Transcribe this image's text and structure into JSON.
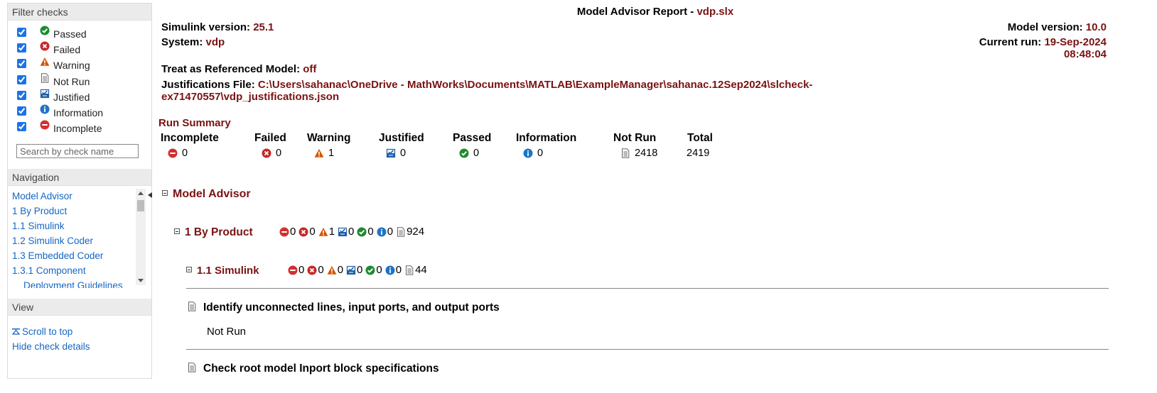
{
  "sidebar": {
    "filter": {
      "header": "Filter checks",
      "items": [
        {
          "label": "Passed",
          "icon": "passed-icon",
          "checked": true
        },
        {
          "label": "Failed",
          "icon": "failed-icon",
          "checked": true
        },
        {
          "label": "Warning",
          "icon": "warning-icon",
          "checked": true
        },
        {
          "label": "Not Run",
          "icon": "not-run-icon",
          "checked": true
        },
        {
          "label": "Justified",
          "icon": "justified-icon",
          "checked": true
        },
        {
          "label": "Information",
          "icon": "information-icon",
          "checked": true
        },
        {
          "label": "Incomplete",
          "icon": "incomplete-icon",
          "checked": true
        }
      ],
      "search_placeholder": "Search by check name"
    },
    "navigation": {
      "header": "Navigation",
      "items": [
        {
          "label": "Model Advisor"
        },
        {
          "label": "1 By Product"
        },
        {
          "label": "1.1 Simulink"
        },
        {
          "label": "1.2 Simulink Coder"
        },
        {
          "label": "1.3 Embedded Coder"
        },
        {
          "label": "1.3.1 Component"
        },
        {
          "label": "Deployment Guidelines"
        }
      ]
    },
    "view": {
      "header": "View",
      "scroll_to_top": "Scroll to top",
      "hide_details": "Hide check details"
    }
  },
  "report": {
    "title_prefix": "Model Advisor Report - ",
    "title_file": "vdp.slx",
    "simulink_version_label": "Simulink version: ",
    "simulink_version": "25.1",
    "system_label": "System: ",
    "system": "vdp",
    "model_version_label": "Model version: ",
    "model_version": "10.0",
    "current_run_label": "Current run: ",
    "current_run_date": "19-Sep-2024",
    "current_run_time": "08:48:04",
    "treat_label": "Treat as Referenced Model: ",
    "treat_value": "off",
    "justifications_label": "Justifications File: ",
    "justifications_line1": "C:\\Users\\sahanac\\OneDrive - MathWorks\\Documents\\MATLAB\\ExampleManager\\sahanac.12Sep2024\\slcheck-",
    "justifications_line2": "ex71470557\\vdp_justifications.json"
  },
  "run_summary": {
    "title": "Run Summary",
    "columns": [
      {
        "label": "Incomplete",
        "value": "0",
        "icon": "incomplete-icon"
      },
      {
        "label": "Failed",
        "value": "0",
        "icon": "failed-icon"
      },
      {
        "label": "Warning",
        "value": "1",
        "icon": "warning-icon"
      },
      {
        "label": "Justified",
        "value": "0",
        "icon": "justified-icon"
      },
      {
        "label": "Passed",
        "value": "0",
        "icon": "passed-icon"
      },
      {
        "label": "Information",
        "value": "0",
        "icon": "information-icon"
      },
      {
        "label": "Not Run",
        "value": "2418",
        "icon": "not-run-icon"
      },
      {
        "label": "Total",
        "value": "2419",
        "icon": ""
      }
    ]
  },
  "tree": {
    "root": {
      "title": "Model Advisor"
    },
    "by_product": {
      "title": "1 By Product",
      "counts": {
        "incomplete": "0",
        "failed": "0",
        "warning": "1",
        "justified": "0",
        "passed": "0",
        "information": "0",
        "not_run": "924"
      }
    },
    "simulink": {
      "title": "1.1 Simulink",
      "counts": {
        "incomplete": "0",
        "failed": "0",
        "warning": "0",
        "justified": "0",
        "passed": "0",
        "information": "0",
        "not_run": "44"
      }
    },
    "checks": [
      {
        "title": "Identify unconnected lines, input ports, and output ports",
        "status": "Not Run"
      },
      {
        "title": "Check root model Inport block specifications",
        "status": ""
      }
    ]
  },
  "colors": {
    "accent_value": "#7a1212",
    "link": "#1466c4",
    "passed": "#1e8a2e",
    "failed": "#c62828",
    "warning": "#d35400",
    "info": "#1e73c8",
    "incomplete": "#d32f2f"
  }
}
